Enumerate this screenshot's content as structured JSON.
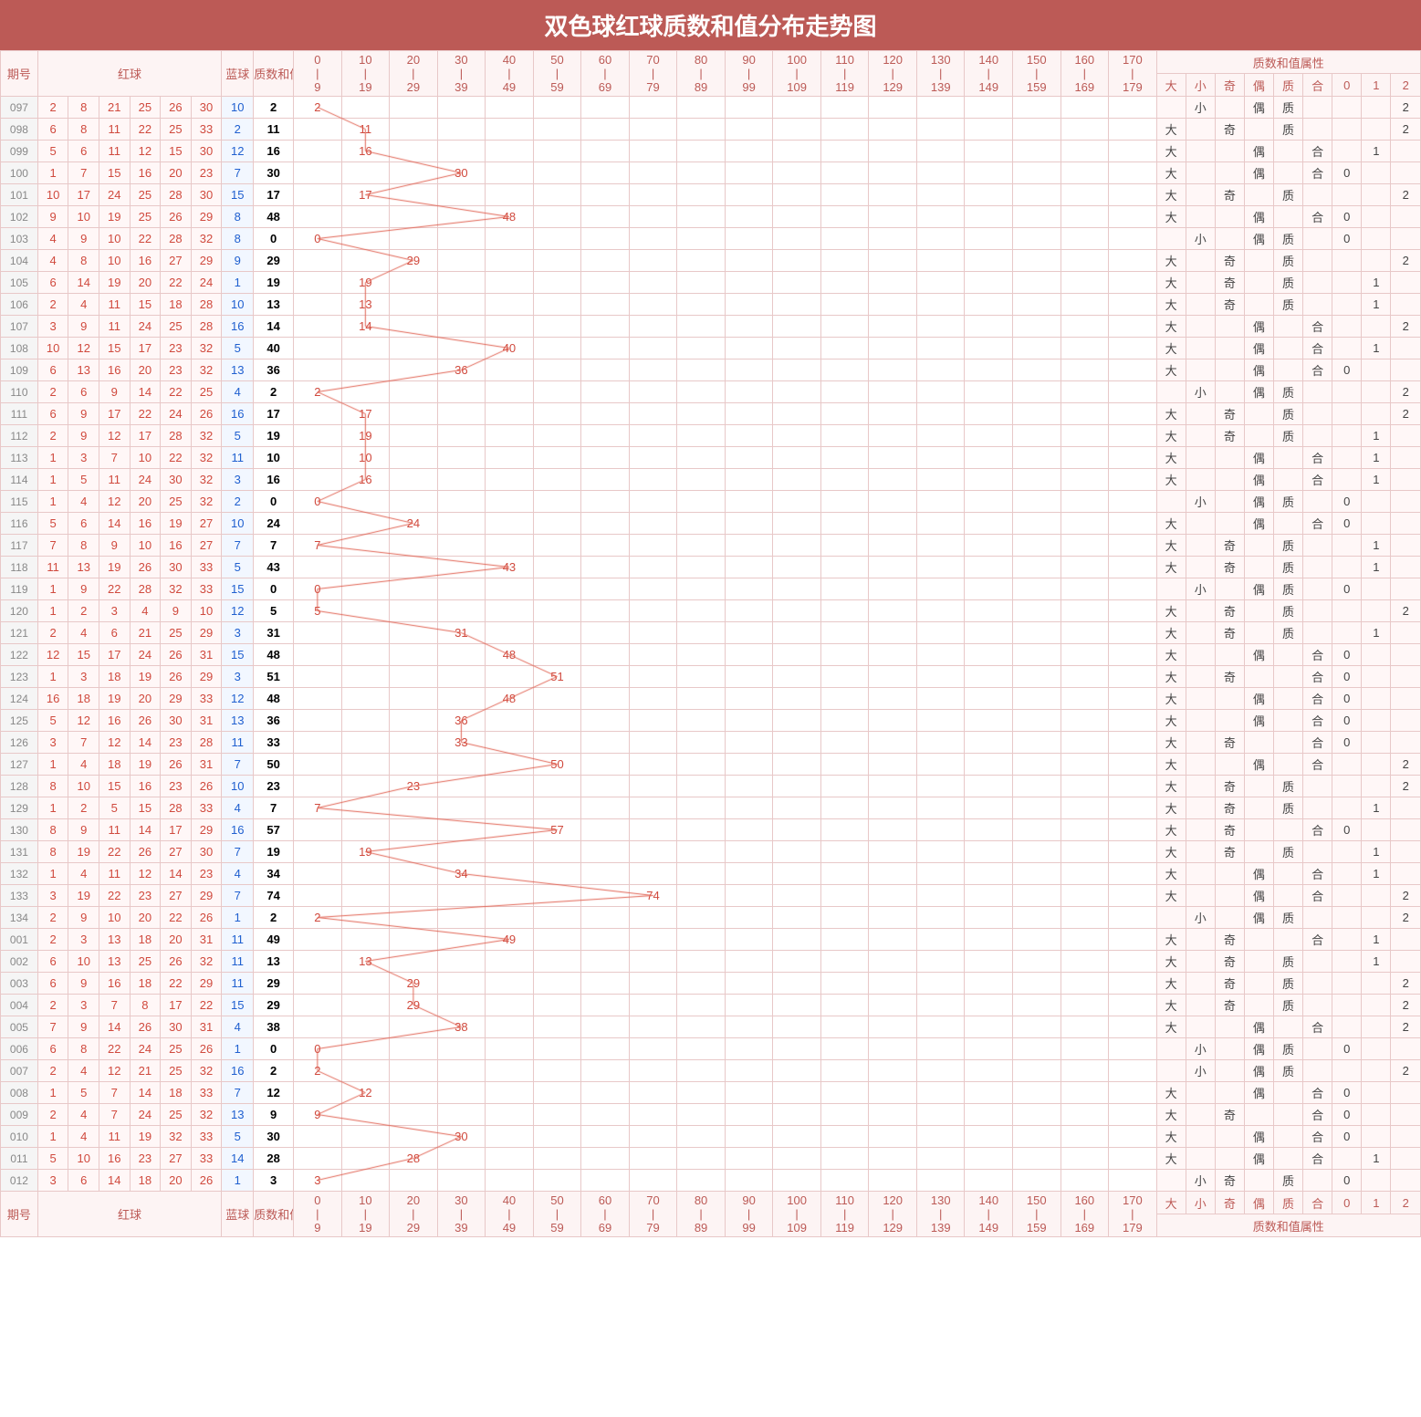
{
  "title": "双色球红球质数和值分布走势图",
  "headers": {
    "period": "期号",
    "red": "红球",
    "blue": "蓝球",
    "sum": "质数和值",
    "prop_group": "质数和值属性",
    "props": [
      "大",
      "小",
      "奇",
      "偶",
      "质",
      "合",
      "0",
      "1",
      "2"
    ]
  },
  "dist_ranges": [
    {
      "lo": 0,
      "hi": 9
    },
    {
      "lo": 10,
      "hi": 19
    },
    {
      "lo": 20,
      "hi": 29
    },
    {
      "lo": 30,
      "hi": 39
    },
    {
      "lo": 40,
      "hi": 49
    },
    {
      "lo": 50,
      "hi": 59
    },
    {
      "lo": 60,
      "hi": 69
    },
    {
      "lo": 70,
      "hi": 79
    },
    {
      "lo": 80,
      "hi": 89
    },
    {
      "lo": 90,
      "hi": 99
    },
    {
      "lo": 100,
      "hi": 109
    },
    {
      "lo": 110,
      "hi": 119
    },
    {
      "lo": 120,
      "hi": 129
    },
    {
      "lo": 130,
      "hi": 139
    },
    {
      "lo": 140,
      "hi": 149
    },
    {
      "lo": 150,
      "hi": 159
    },
    {
      "lo": 160,
      "hi": 169
    },
    {
      "lo": 170,
      "hi": 179
    }
  ],
  "chart_data": {
    "type": "table",
    "title": "双色球红球质数和值分布走势图",
    "rows": [
      {
        "p": "097",
        "r": [
          2,
          8,
          21,
          25,
          26,
          30
        ],
        "b": 10,
        "s": 2,
        "prop": {
          "size": "小",
          "parity": "偶",
          "pc": "质",
          "tail": "2"
        }
      },
      {
        "p": "098",
        "r": [
          6,
          8,
          11,
          22,
          25,
          33
        ],
        "b": 2,
        "s": 11,
        "prop": {
          "size": "大",
          "parity": "奇",
          "pc": "质",
          "tail": "2"
        }
      },
      {
        "p": "099",
        "r": [
          5,
          6,
          11,
          12,
          15,
          30
        ],
        "b": 12,
        "s": 16,
        "prop": {
          "size": "大",
          "parity": "偶",
          "pc": "合",
          "tail": "1"
        }
      },
      {
        "p": "100",
        "r": [
          1,
          7,
          15,
          16,
          20,
          23
        ],
        "b": 7,
        "s": 30,
        "prop": {
          "size": "大",
          "parity": "偶",
          "pc": "合",
          "tail": "0"
        }
      },
      {
        "p": "101",
        "r": [
          10,
          17,
          24,
          25,
          28,
          30
        ],
        "b": 15,
        "s": 17,
        "prop": {
          "size": "大",
          "parity": "奇",
          "pc": "质",
          "tail": "2"
        }
      },
      {
        "p": "102",
        "r": [
          9,
          10,
          19,
          25,
          26,
          29
        ],
        "b": 8,
        "s": 48,
        "prop": {
          "size": "大",
          "parity": "偶",
          "pc": "合",
          "tail": "0"
        }
      },
      {
        "p": "103",
        "r": [
          4,
          9,
          10,
          22,
          28,
          32
        ],
        "b": 8,
        "s": 0,
        "prop": {
          "size": "小",
          "parity": "偶",
          "pc": "质",
          "tail": "0"
        }
      },
      {
        "p": "104",
        "r": [
          4,
          8,
          10,
          16,
          27,
          29
        ],
        "b": 9,
        "s": 29,
        "prop": {
          "size": "大",
          "parity": "奇",
          "pc": "质",
          "tail": "2"
        }
      },
      {
        "p": "105",
        "r": [
          6,
          14,
          19,
          20,
          22,
          24
        ],
        "b": 1,
        "s": 19,
        "prop": {
          "size": "大",
          "parity": "奇",
          "pc": "质",
          "tail": "1"
        }
      },
      {
        "p": "106",
        "r": [
          2,
          4,
          11,
          15,
          18,
          28
        ],
        "b": 10,
        "s": 13,
        "prop": {
          "size": "大",
          "parity": "奇",
          "pc": "质",
          "tail": "1"
        }
      },
      {
        "p": "107",
        "r": [
          3,
          9,
          11,
          24,
          25,
          28
        ],
        "b": 16,
        "s": 14,
        "prop": {
          "size": "大",
          "parity": "偶",
          "pc": "合",
          "tail": "2"
        }
      },
      {
        "p": "108",
        "r": [
          10,
          12,
          15,
          17,
          23,
          32
        ],
        "b": 5,
        "s": 40,
        "prop": {
          "size": "大",
          "parity": "偶",
          "pc": "合",
          "tail": "1"
        }
      },
      {
        "p": "109",
        "r": [
          6,
          13,
          16,
          20,
          23,
          32
        ],
        "b": 13,
        "s": 36,
        "prop": {
          "size": "大",
          "parity": "偶",
          "pc": "合",
          "tail": "0"
        }
      },
      {
        "p": "110",
        "r": [
          2,
          6,
          9,
          14,
          22,
          25
        ],
        "b": 4,
        "s": 2,
        "prop": {
          "size": "小",
          "parity": "偶",
          "pc": "质",
          "tail": "2"
        }
      },
      {
        "p": "111",
        "r": [
          6,
          9,
          17,
          22,
          24,
          26
        ],
        "b": 16,
        "s": 17,
        "prop": {
          "size": "大",
          "parity": "奇",
          "pc": "质",
          "tail": "2"
        }
      },
      {
        "p": "112",
        "r": [
          2,
          9,
          12,
          17,
          28,
          32
        ],
        "b": 5,
        "s": 19,
        "prop": {
          "size": "大",
          "parity": "奇",
          "pc": "质",
          "tail": "1"
        }
      },
      {
        "p": "113",
        "r": [
          1,
          3,
          7,
          10,
          22,
          32
        ],
        "b": 11,
        "s": 10,
        "prop": {
          "size": "大",
          "parity": "偶",
          "pc": "合",
          "tail": "1"
        }
      },
      {
        "p": "114",
        "r": [
          1,
          5,
          11,
          24,
          30,
          32
        ],
        "b": 3,
        "s": 16,
        "prop": {
          "size": "大",
          "parity": "偶",
          "pc": "合",
          "tail": "1"
        }
      },
      {
        "p": "115",
        "r": [
          1,
          4,
          12,
          20,
          25,
          32
        ],
        "b": 2,
        "s": 0,
        "prop": {
          "size": "小",
          "parity": "偶",
          "pc": "质",
          "tail": "0"
        }
      },
      {
        "p": "116",
        "r": [
          5,
          6,
          14,
          16,
          19,
          27
        ],
        "b": 10,
        "s": 24,
        "prop": {
          "size": "大",
          "parity": "偶",
          "pc": "合",
          "tail": "0"
        }
      },
      {
        "p": "117",
        "r": [
          7,
          8,
          9,
          10,
          16,
          27
        ],
        "b": 7,
        "s": 7,
        "prop": {
          "size": "大",
          "parity": "奇",
          "pc": "质",
          "tail": "1"
        }
      },
      {
        "p": "118",
        "r": [
          11,
          13,
          19,
          26,
          30,
          33
        ],
        "b": 5,
        "s": 43,
        "prop": {
          "size": "大",
          "parity": "奇",
          "pc": "质",
          "tail": "1"
        }
      },
      {
        "p": "119",
        "r": [
          1,
          9,
          22,
          28,
          32,
          33
        ],
        "b": 15,
        "s": 0,
        "prop": {
          "size": "小",
          "parity": "偶",
          "pc": "质",
          "tail": "0"
        }
      },
      {
        "p": "120",
        "r": [
          1,
          2,
          3,
          4,
          9,
          10
        ],
        "b": 12,
        "s": 5,
        "prop": {
          "size": "大",
          "parity": "奇",
          "pc": "质",
          "tail": "2"
        }
      },
      {
        "p": "121",
        "r": [
          2,
          4,
          6,
          21,
          25,
          29
        ],
        "b": 3,
        "s": 31,
        "prop": {
          "size": "大",
          "parity": "奇",
          "pc": "质",
          "tail": "1"
        }
      },
      {
        "p": "122",
        "r": [
          12,
          15,
          17,
          24,
          26,
          31
        ],
        "b": 15,
        "s": 48,
        "prop": {
          "size": "大",
          "parity": "偶",
          "pc": "合",
          "tail": "0"
        }
      },
      {
        "p": "123",
        "r": [
          1,
          3,
          18,
          19,
          26,
          29
        ],
        "b": 3,
        "s": 51,
        "prop": {
          "size": "大",
          "parity": "奇",
          "pc": "合",
          "tail": "0"
        }
      },
      {
        "p": "124",
        "r": [
          16,
          18,
          19,
          20,
          29,
          33
        ],
        "b": 12,
        "s": 48,
        "prop": {
          "size": "大",
          "parity": "偶",
          "pc": "合",
          "tail": "0"
        }
      },
      {
        "p": "125",
        "r": [
          5,
          12,
          16,
          26,
          30,
          31
        ],
        "b": 13,
        "s": 36,
        "prop": {
          "size": "大",
          "parity": "偶",
          "pc": "合",
          "tail": "0"
        }
      },
      {
        "p": "126",
        "r": [
          3,
          7,
          12,
          14,
          23,
          28
        ],
        "b": 11,
        "s": 33,
        "prop": {
          "size": "大",
          "parity": "奇",
          "pc": "合",
          "tail": "0"
        }
      },
      {
        "p": "127",
        "r": [
          1,
          4,
          18,
          19,
          26,
          31
        ],
        "b": 7,
        "s": 50,
        "prop": {
          "size": "大",
          "parity": "偶",
          "pc": "合",
          "tail": "2"
        }
      },
      {
        "p": "128",
        "r": [
          8,
          10,
          15,
          16,
          23,
          26
        ],
        "b": 10,
        "s": 23,
        "prop": {
          "size": "大",
          "parity": "奇",
          "pc": "质",
          "tail": "2"
        }
      },
      {
        "p": "129",
        "r": [
          1,
          2,
          5,
          15,
          28,
          33
        ],
        "b": 4,
        "s": 7,
        "prop": {
          "size": "大",
          "parity": "奇",
          "pc": "质",
          "tail": "1"
        }
      },
      {
        "p": "130",
        "r": [
          8,
          9,
          11,
          14,
          17,
          29
        ],
        "b": 16,
        "s": 57,
        "prop": {
          "size": "大",
          "parity": "奇",
          "pc": "合",
          "tail": "0"
        }
      },
      {
        "p": "131",
        "r": [
          8,
          19,
          22,
          26,
          27,
          30
        ],
        "b": 7,
        "s": 19,
        "prop": {
          "size": "大",
          "parity": "奇",
          "pc": "质",
          "tail": "1"
        }
      },
      {
        "p": "132",
        "r": [
          1,
          4,
          11,
          12,
          14,
          23
        ],
        "b": 4,
        "s": 34,
        "prop": {
          "size": "大",
          "parity": "偶",
          "pc": "合",
          "tail": "1"
        }
      },
      {
        "p": "133",
        "r": [
          3,
          19,
          22,
          23,
          27,
          29
        ],
        "b": 7,
        "s": 74,
        "prop": {
          "size": "大",
          "parity": "偶",
          "pc": "合",
          "tail": "2"
        }
      },
      {
        "p": "134",
        "r": [
          2,
          9,
          10,
          20,
          22,
          26
        ],
        "b": 1,
        "s": 2,
        "prop": {
          "size": "小",
          "parity": "偶",
          "pc": "质",
          "tail": "2"
        }
      },
      {
        "p": "001",
        "r": [
          2,
          3,
          13,
          18,
          20,
          31
        ],
        "b": 11,
        "s": 49,
        "prop": {
          "size": "大",
          "parity": "奇",
          "pc": "合",
          "tail": "1"
        }
      },
      {
        "p": "002",
        "r": [
          6,
          10,
          13,
          25,
          26,
          32
        ],
        "b": 11,
        "s": 13,
        "prop": {
          "size": "大",
          "parity": "奇",
          "pc": "质",
          "tail": "1"
        }
      },
      {
        "p": "003",
        "r": [
          6,
          9,
          16,
          18,
          22,
          29
        ],
        "b": 11,
        "s": 29,
        "prop": {
          "size": "大",
          "parity": "奇",
          "pc": "质",
          "tail": "2"
        }
      },
      {
        "p": "004",
        "r": [
          2,
          3,
          7,
          8,
          17,
          22
        ],
        "b": 15,
        "s": 29,
        "prop": {
          "size": "大",
          "parity": "奇",
          "pc": "质",
          "tail": "2"
        }
      },
      {
        "p": "005",
        "r": [
          7,
          9,
          14,
          26,
          30,
          31
        ],
        "b": 4,
        "s": 38,
        "prop": {
          "size": "大",
          "parity": "偶",
          "pc": "合",
          "tail": "2"
        }
      },
      {
        "p": "006",
        "r": [
          6,
          8,
          22,
          24,
          25,
          26
        ],
        "b": 1,
        "s": 0,
        "prop": {
          "size": "小",
          "parity": "偶",
          "pc": "质",
          "tail": "0"
        }
      },
      {
        "p": "007",
        "r": [
          2,
          4,
          12,
          21,
          25,
          32
        ],
        "b": 16,
        "s": 2,
        "prop": {
          "size": "小",
          "parity": "偶",
          "pc": "质",
          "tail": "2"
        }
      },
      {
        "p": "008",
        "r": [
          1,
          5,
          7,
          14,
          18,
          33
        ],
        "b": 7,
        "s": 12,
        "prop": {
          "size": "大",
          "parity": "偶",
          "pc": "合",
          "tail": "0"
        }
      },
      {
        "p": "009",
        "r": [
          2,
          4,
          7,
          24,
          25,
          32
        ],
        "b": 13,
        "s": 9,
        "prop": {
          "size": "大",
          "parity": "奇",
          "pc": "合",
          "tail": "0"
        }
      },
      {
        "p": "010",
        "r": [
          1,
          4,
          11,
          19,
          32,
          33
        ],
        "b": 5,
        "s": 30,
        "prop": {
          "size": "大",
          "parity": "偶",
          "pc": "合",
          "tail": "0"
        }
      },
      {
        "p": "011",
        "r": [
          5,
          10,
          16,
          23,
          27,
          33
        ],
        "b": 14,
        "s": 28,
        "prop": {
          "size": "大",
          "parity": "偶",
          "pc": "合",
          "tail": "1"
        }
      },
      {
        "p": "012",
        "r": [
          3,
          6,
          14,
          18,
          20,
          26
        ],
        "b": 1,
        "s": 3,
        "prop": {
          "size": "小",
          "parity": "奇",
          "pc": "质",
          "tail": "0"
        }
      }
    ]
  }
}
